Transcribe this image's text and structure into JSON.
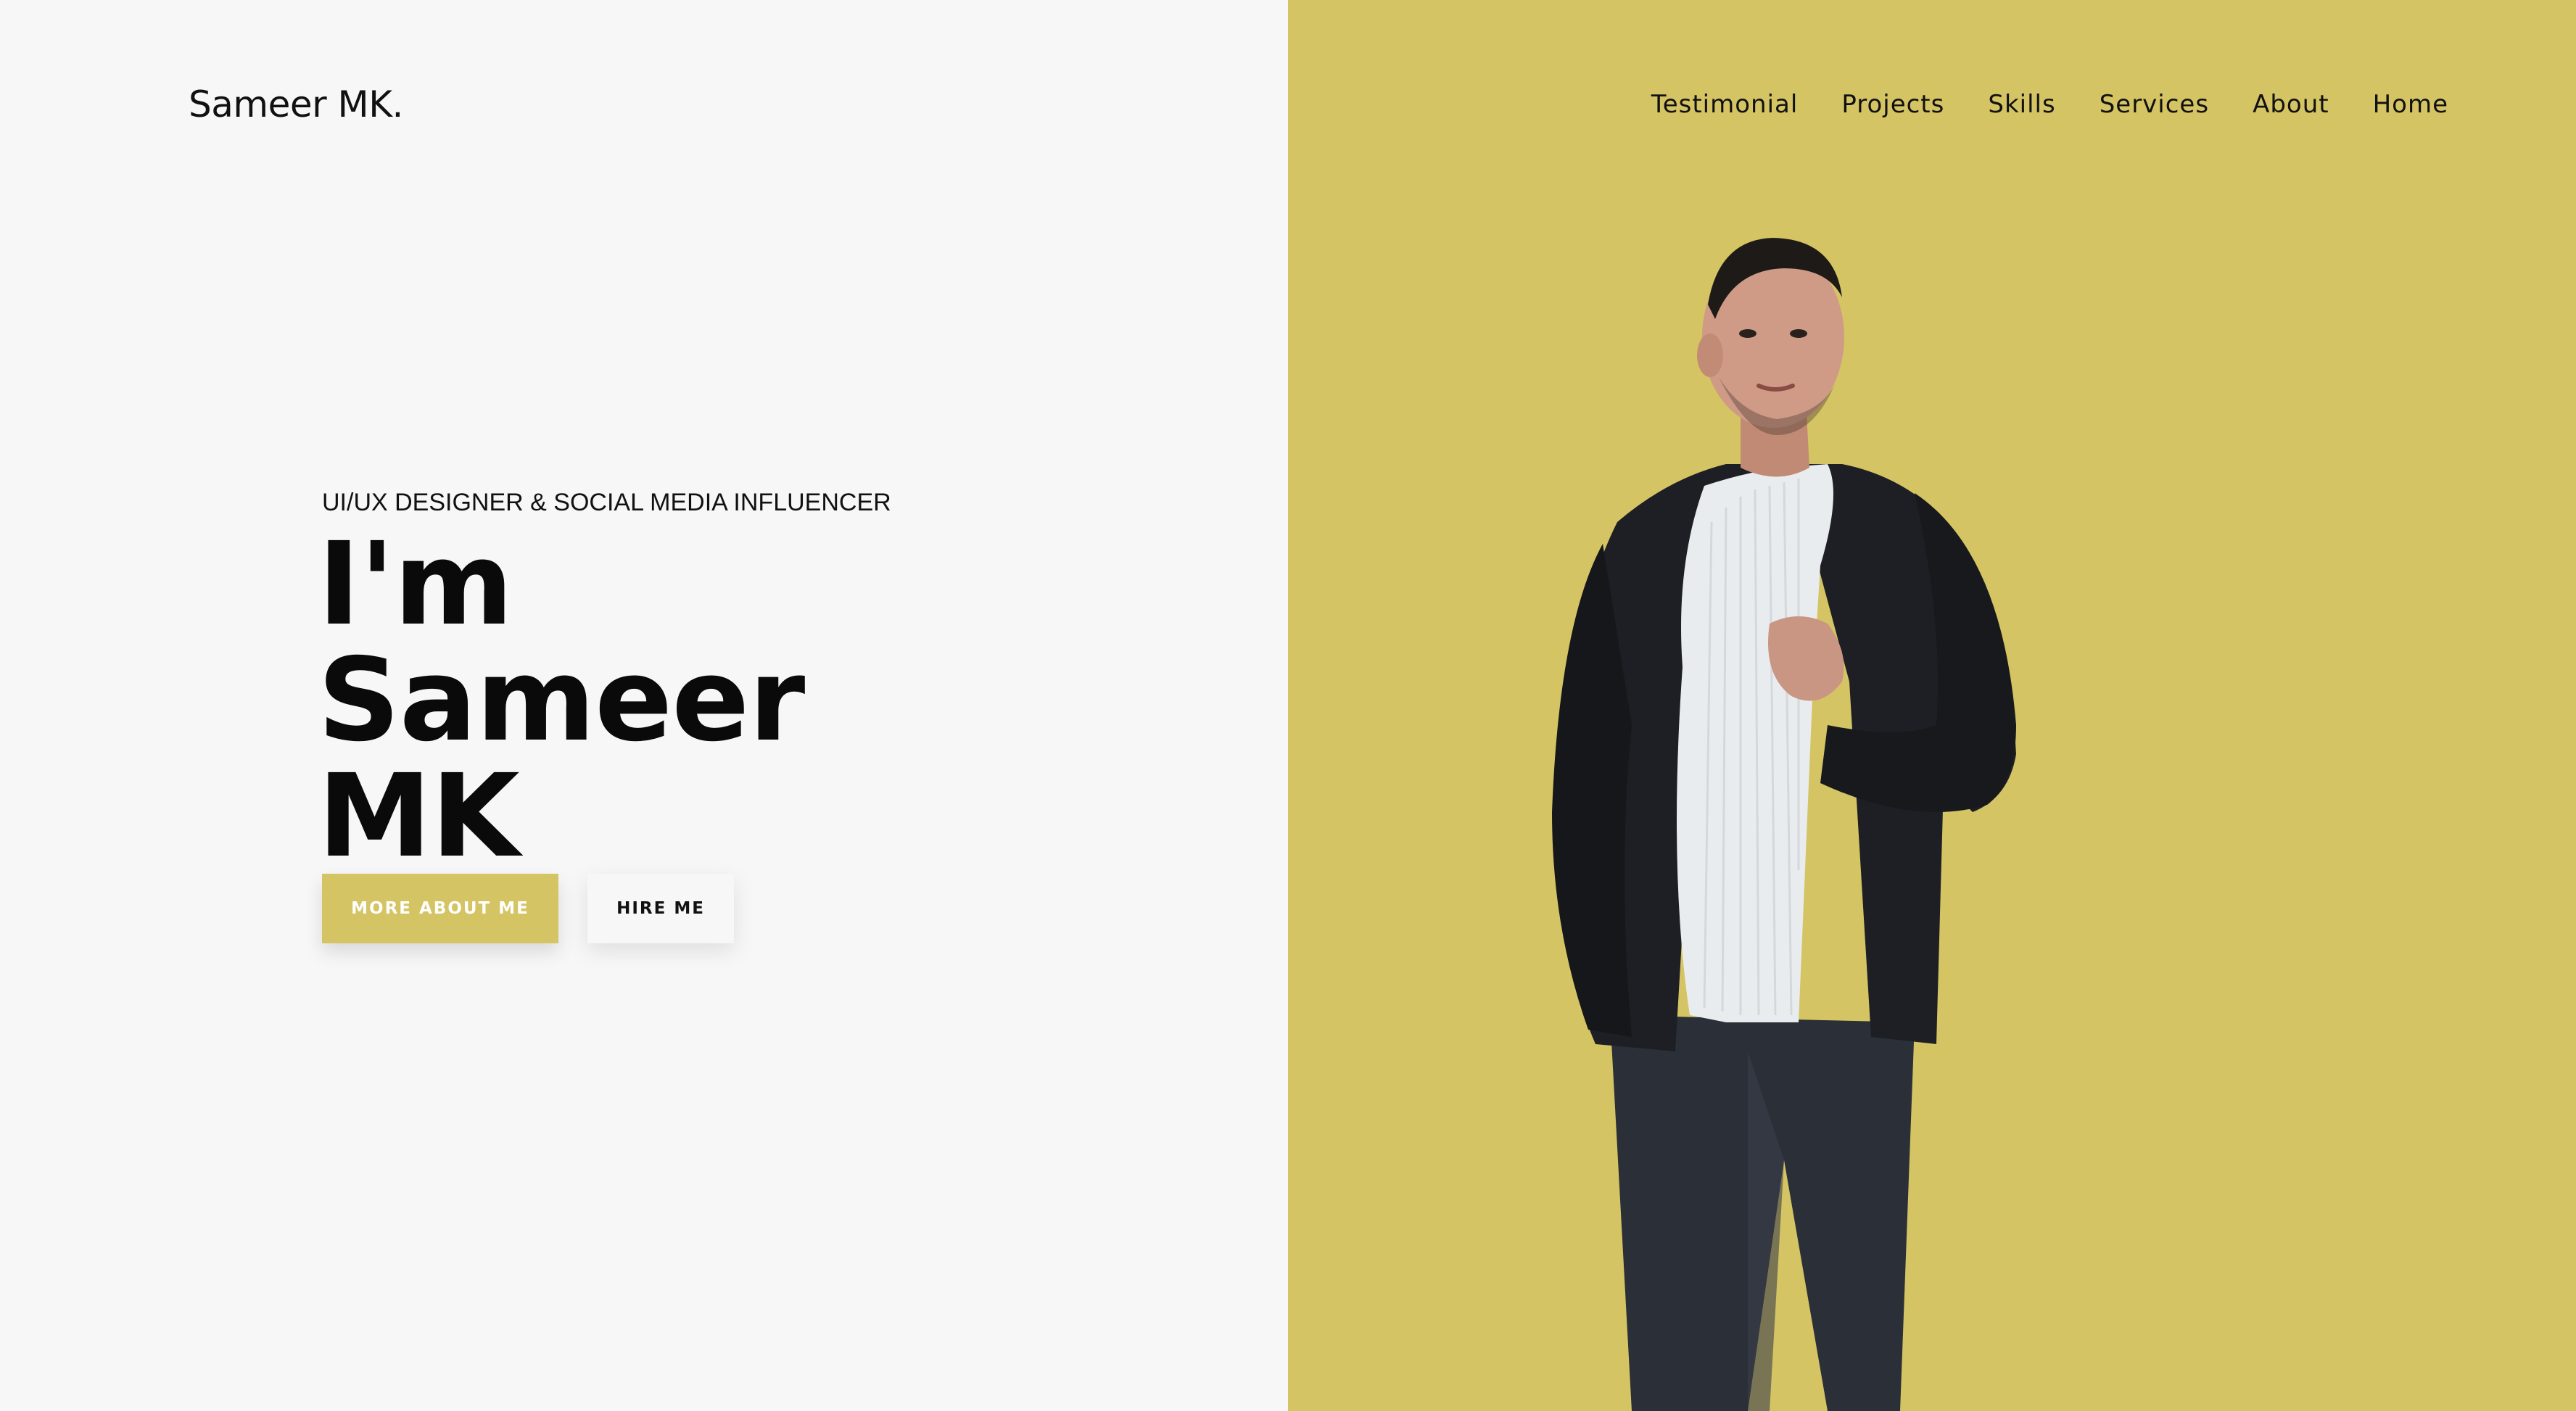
{
  "header": {
    "logo": "Sameer MK.",
    "nav": [
      "Testimonial",
      "Projects",
      "Skills",
      "Services",
      "About",
      "Home"
    ]
  },
  "hero": {
    "subtitle": "UI/UX DESIGNER & SOCIAL MEDIA INFLUENCER",
    "headline_lines": [
      "I'm",
      "Sameer",
      "MK"
    ],
    "primary_button": "MORE ABOUT ME",
    "secondary_button": "HIRE ME"
  },
  "colors": {
    "accent": "#d4c464",
    "background": "#f7f7f7",
    "text": "#0a0a0a"
  }
}
